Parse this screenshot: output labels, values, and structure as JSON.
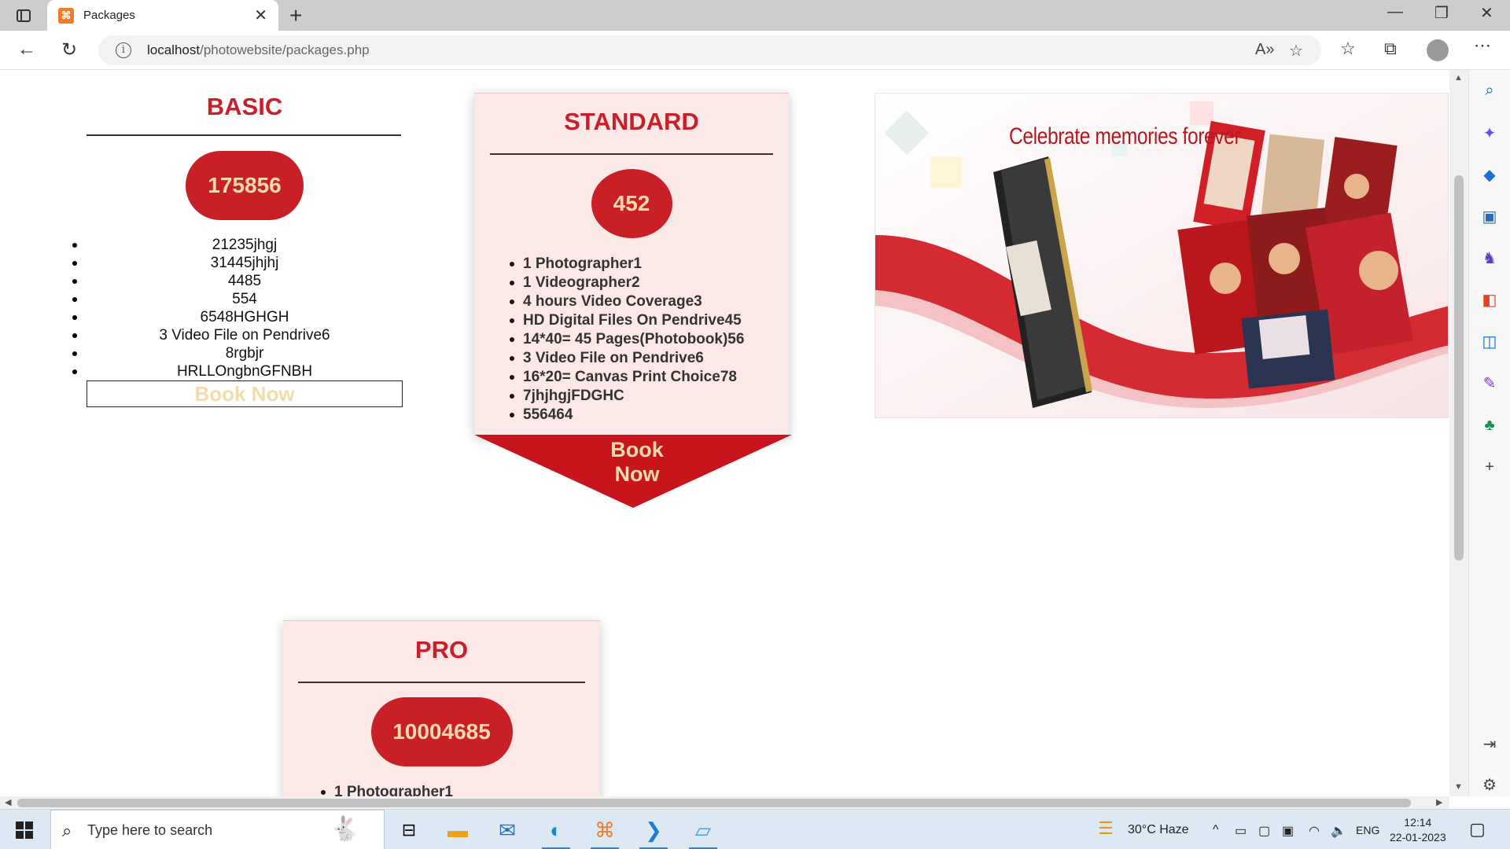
{
  "browser": {
    "tab_title": "Packages",
    "url_host": "localhost",
    "url_path": "/photowebsite/packages.php"
  },
  "page": {
    "basic": {
      "title": "BASIC",
      "price": "175856",
      "items": [
        "21235jhgj",
        "31445jhjhj",
        "4485",
        "554",
        "6548HGHGH",
        "3 Video File on Pendrive6",
        "8rgbjr",
        "HRLLOngbnGFNBH"
      ],
      "book_label": "Book Now"
    },
    "standard": {
      "title": "STANDARD",
      "price": "452",
      "items": [
        "1 Photographer1",
        "1 Videographer2",
        "4 hours Video Coverage3",
        "HD Digital Files On Pendrive45",
        "14*40= 45 Pages(Photobook)56",
        "3 Video File on Pendrive6",
        "16*20= Canvas Print Choice78",
        "7jhjhgjFDGHC",
        "556464"
      ],
      "book_label_1": "Book",
      "book_label_2": "Now"
    },
    "pro": {
      "title": "PRO",
      "price": "10004685",
      "items": [
        "1 Photographer1"
      ]
    },
    "banner": {
      "text": "Celebrate memories forever"
    }
  },
  "taskbar": {
    "search_placeholder": "Type here to search",
    "weather": "30°C  Haze",
    "language": "ENG",
    "time": "12:14",
    "date": "22-01-2023"
  },
  "colors": {
    "accent_red": "#c91f26",
    "price_text": "#f3dcaa",
    "card_bg": "#fde8e8"
  }
}
